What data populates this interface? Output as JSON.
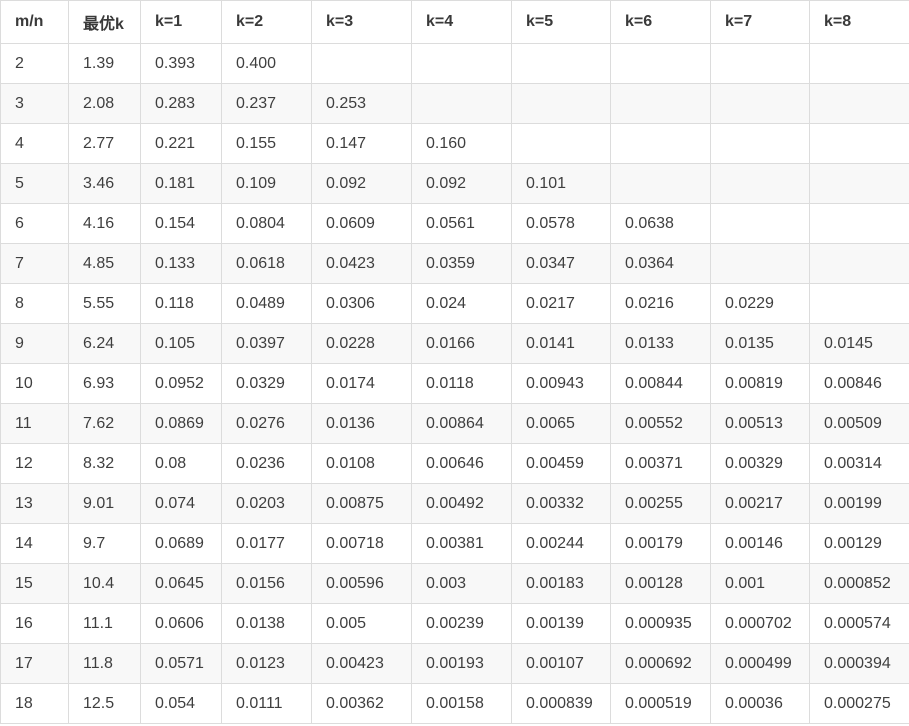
{
  "table": {
    "headers": [
      "m/n",
      "最优k",
      "k=1",
      "k=2",
      "k=3",
      "k=4",
      "k=5",
      "k=6",
      "k=7",
      "k=8"
    ],
    "rows": [
      [
        "2",
        "1.39",
        "0.393",
        "0.400",
        "",
        "",
        "",
        "",
        "",
        ""
      ],
      [
        "3",
        "2.08",
        "0.283",
        "0.237",
        "0.253",
        "",
        "",
        "",
        "",
        ""
      ],
      [
        "4",
        "2.77",
        "0.221",
        "0.155",
        "0.147",
        "0.160",
        "",
        "",
        "",
        ""
      ],
      [
        "5",
        "3.46",
        "0.181",
        "0.109",
        "0.092",
        "0.092",
        "0.101",
        "",
        "",
        ""
      ],
      [
        "6",
        "4.16",
        "0.154",
        "0.0804",
        "0.0609",
        "0.0561",
        "0.0578",
        "0.0638",
        "",
        ""
      ],
      [
        "7",
        "4.85",
        "0.133",
        "0.0618",
        "0.0423",
        "0.0359",
        "0.0347",
        "0.0364",
        "",
        ""
      ],
      [
        "8",
        "5.55",
        "0.118",
        "0.0489",
        "0.0306",
        "0.024",
        "0.0217",
        "0.0216",
        "0.0229",
        ""
      ],
      [
        "9",
        "6.24",
        "0.105",
        "0.0397",
        "0.0228",
        "0.0166",
        "0.0141",
        "0.0133",
        "0.0135",
        "0.0145"
      ],
      [
        "10",
        "6.93",
        "0.0952",
        "0.0329",
        "0.0174",
        "0.0118",
        "0.00943",
        "0.00844",
        "0.00819",
        "0.00846"
      ],
      [
        "11",
        "7.62",
        "0.0869",
        "0.0276",
        "0.0136",
        "0.00864",
        "0.0065",
        "0.00552",
        "0.00513",
        "0.00509"
      ],
      [
        "12",
        "8.32",
        "0.08",
        "0.0236",
        "0.0108",
        "0.00646",
        "0.00459",
        "0.00371",
        "0.00329",
        "0.00314"
      ],
      [
        "13",
        "9.01",
        "0.074",
        "0.0203",
        "0.00875",
        "0.00492",
        "0.00332",
        "0.00255",
        "0.00217",
        "0.00199"
      ],
      [
        "14",
        "9.7",
        "0.0689",
        "0.0177",
        "0.00718",
        "0.00381",
        "0.00244",
        "0.00179",
        "0.00146",
        "0.00129"
      ],
      [
        "15",
        "10.4",
        "0.0645",
        "0.0156",
        "0.00596",
        "0.003",
        "0.00183",
        "0.00128",
        "0.001",
        "0.000852"
      ],
      [
        "16",
        "11.1",
        "0.0606",
        "0.0138",
        "0.005",
        "0.00239",
        "0.00139",
        "0.000935",
        "0.000702",
        "0.000574"
      ],
      [
        "17",
        "11.8",
        "0.0571",
        "0.0123",
        "0.00423",
        "0.00193",
        "0.00107",
        "0.000692",
        "0.000499",
        "0.000394"
      ],
      [
        "18",
        "12.5",
        "0.054",
        "0.0111",
        "0.00362",
        "0.00158",
        "0.000839",
        "0.000519",
        "0.00036",
        "0.000275"
      ]
    ]
  }
}
